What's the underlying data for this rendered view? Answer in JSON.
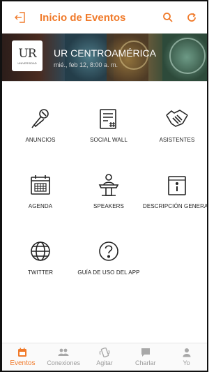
{
  "header": {
    "title": "Inicio de Eventos"
  },
  "banner": {
    "event_title": "UR CENTROAMÉRICA",
    "event_date": "mié., feb 12, 8:00 a. m.",
    "logo_text": "UR",
    "logo_sub": "UNIVERSIDAD"
  },
  "menu": [
    {
      "label": "ANUNCIOS",
      "icon": "microphone-icon"
    },
    {
      "label": "SOCIAL WALL",
      "icon": "social-wall-icon"
    },
    {
      "label": "ASISTENTES",
      "icon": "handshake-icon"
    },
    {
      "label": "AGENDA",
      "icon": "calendar-icon"
    },
    {
      "label": "SPEAKERS",
      "icon": "podium-speaker-icon"
    },
    {
      "label": "DESCRIPCIÓN GENERAL",
      "icon": "info-document-icon"
    },
    {
      "label": "TWITTER",
      "icon": "globe-icon"
    },
    {
      "label": "GUÍA DE USO DEL APP",
      "icon": "question-circle-icon"
    }
  ],
  "bottom_nav": [
    {
      "label": "Eventos",
      "active": true
    },
    {
      "label": "Conexiones",
      "active": false
    },
    {
      "label": "Agitar",
      "active": false
    },
    {
      "label": "Charlar",
      "active": false
    },
    {
      "label": "Yo",
      "active": false
    }
  ],
  "colors": {
    "accent": "#f07a2a",
    "inactive": "#9a9a9a"
  }
}
